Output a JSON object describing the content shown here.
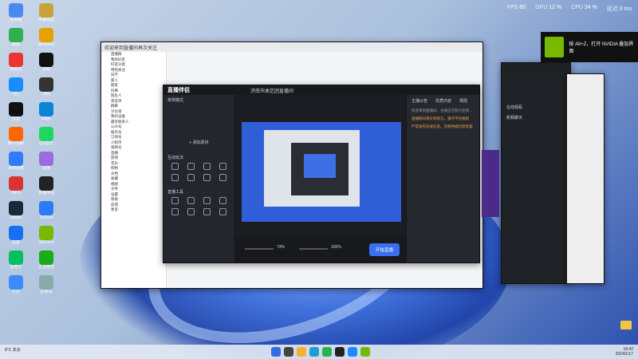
{
  "perf": {
    "fps_label": "FPS",
    "fps": "60",
    "gpu_label": "GPU",
    "gpu": "12 %",
    "cpu_label": "CPU",
    "cpu": "34 %",
    "lat_label": "延迟",
    "lat": "0 ms"
  },
  "notification": {
    "text": "按 Alt+Z，打开 NVIDIA 叠加界面"
  },
  "stream_app": {
    "logo": "直播伴侣",
    "scene_label": "常规模式",
    "user_title": "济南市曲艺团直播间",
    "add_scene": "+ 添加素材",
    "interact_title": "互动玩法",
    "tools_title": "直播工具",
    "tabs": [
      "主播公告",
      "优质内容",
      "规则"
    ],
    "notices": [
      "欢迎来到直播间，主播正在努力连接...",
      "直播期间请文明发言，遵守平台规则",
      "严禁发布违规信息，违者将被封禁处理"
    ],
    "go_live": "开始直播",
    "zoom": "73%",
    "volume": "100%"
  },
  "chat": {
    "title": "欢迎来到直播间再次关注",
    "items": [
      "直播群",
      "我的好友",
      "好友分组",
      "特别关注",
      "同学",
      "家人",
      "朋友",
      "同事",
      "陌生人",
      "黑名单",
      "群聊",
      "讨论组",
      "我的设备",
      "最近联系人",
      "公众号",
      "服务号",
      "订阅号",
      "小程序",
      "视频号",
      "直播",
      "游戏",
      "音乐",
      "购物",
      "文档",
      "收藏",
      "相册",
      "文件",
      "设置",
      "帮助",
      "反馈",
      "更多"
    ]
  },
  "side1": {
    "items": [
      "在线观看",
      "和我聊天"
    ]
  },
  "taskbar": {
    "weather_temp": "8°C",
    "weather_desc": "多云",
    "time": "18:42",
    "date": "2024/1/17"
  },
  "desktop": {
    "icons": [
      "此电脑",
      "微信",
      "网易云",
      "QQ",
      "抖音",
      "腾讯视频",
      "百度网盘",
      "WPS",
      "Steam",
      "迅雷",
      "爱奇艺",
      "钉钉",
      "英雄联盟",
      "WeGame",
      "剪映",
      "OBS",
      "Edge",
      "QQ音乐",
      "原神",
      "直播伴侣",
      "ToDesk",
      "GeForce",
      "企业微信",
      "回收站"
    ]
  }
}
